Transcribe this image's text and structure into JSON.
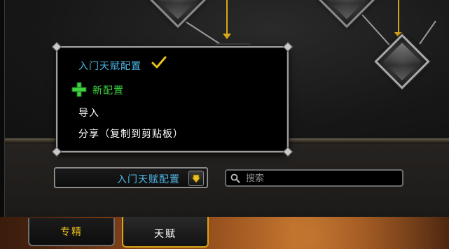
{
  "loadout_menu": {
    "current_label": "入门天赋配置",
    "new_label": "新配置",
    "import_label": "导入",
    "share_label": "分享（复制到剪贴板）"
  },
  "loadout_dropdown": {
    "selected": "入门天赋配置"
  },
  "search": {
    "placeholder": "搜索"
  },
  "tabs": [
    {
      "label": "专精",
      "active": false
    },
    {
      "label": "天赋",
      "active": true
    }
  ],
  "colors": {
    "current_loadout": "#4fb6e8",
    "new_config": "#3fd33f",
    "gold_accent": "#d8a616",
    "tab_inactive_text": "#f0c21f"
  },
  "icons": {
    "check": "checkmark-icon",
    "plus": "plus-icon",
    "dropdown": "chevron-down-icon",
    "search": "magnifier-icon"
  }
}
